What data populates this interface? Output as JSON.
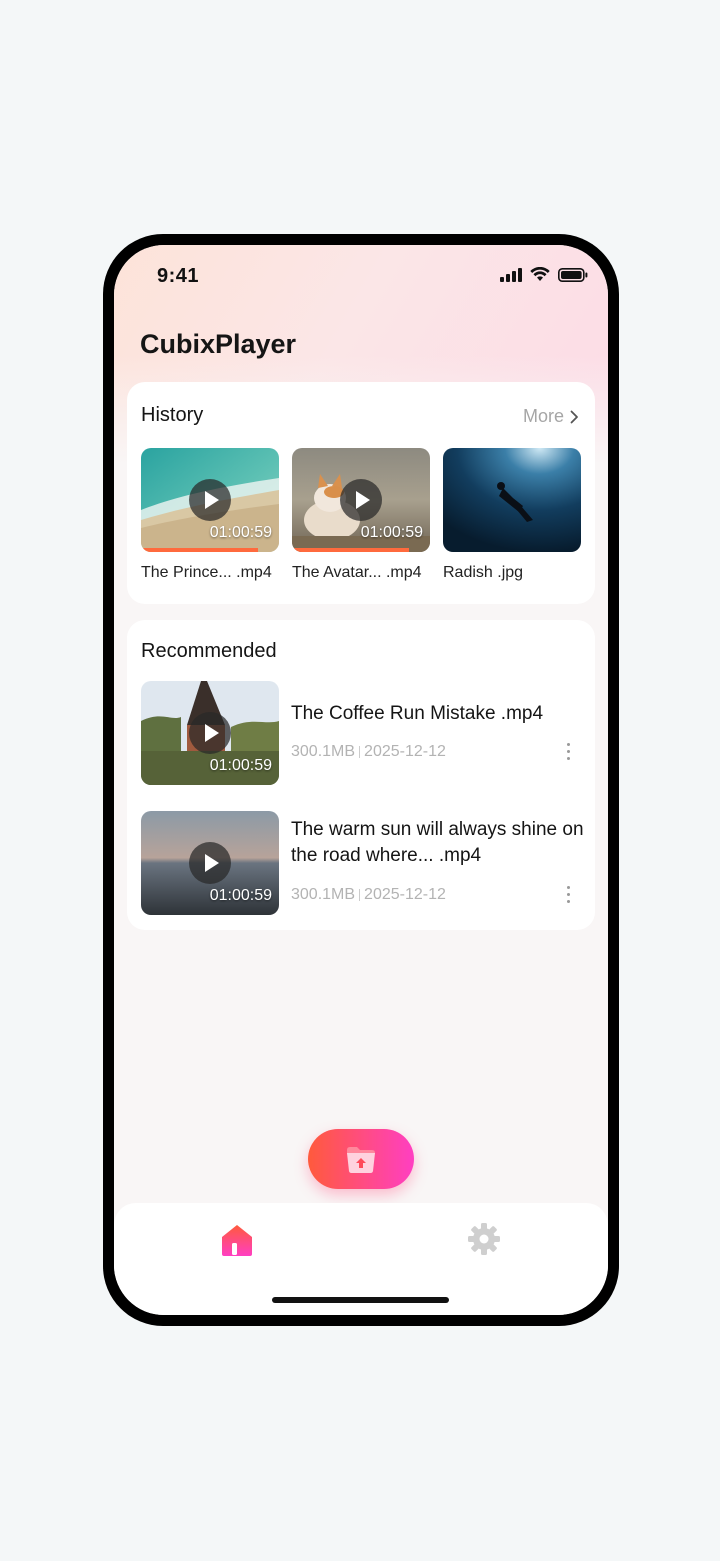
{
  "status_bar": {
    "time": "9:41",
    "icons": [
      "cellular-signal-icon",
      "wifi-icon",
      "battery-icon"
    ]
  },
  "app": {
    "title": "CubixPlayer"
  },
  "history": {
    "title": "History",
    "more_label": "More",
    "items": [
      {
        "label": "The Prince... .mp4",
        "duration": "01:00:59",
        "progress": 0.85,
        "has_play": true
      },
      {
        "label": "The Avatar... .mp4",
        "duration": "01:00:59",
        "progress": 0.85,
        "has_play": true
      },
      {
        "label": "Radish .jpg",
        "duration": "",
        "has_play": false
      }
    ]
  },
  "recommended": {
    "title": "Recommended",
    "items": [
      {
        "title": "The Coffee Run Mistake .mp4",
        "size": "300.1MB",
        "date": "2025-12-12",
        "duration": "01:00:59"
      },
      {
        "title": "The warm sun will always shine on the road where... .mp4",
        "size": "300.1MB",
        "date": "2025-12-12",
        "duration": "01:00:59"
      }
    ]
  },
  "fab": {
    "icon": "folder-upload-icon"
  },
  "tab_bar": {
    "tabs": [
      {
        "name": "home",
        "icon": "home-icon",
        "active": true
      },
      {
        "name": "settings",
        "icon": "gear-icon",
        "active": false
      }
    ]
  },
  "colors": {
    "accent_start": "#ff5a3c",
    "accent_end": "#ff3fc2",
    "progress": "#ff6a3d",
    "muted_text": "#b3b3b3"
  }
}
